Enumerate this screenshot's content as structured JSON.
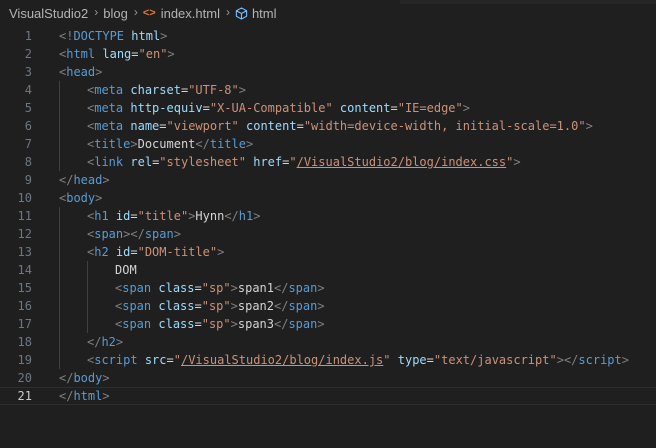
{
  "breadcrumb": {
    "items": [
      "VisualStudio2",
      "blog",
      "index.html",
      "html"
    ],
    "file_icon": "<>",
    "symbol_icon": "cube-icon"
  },
  "editor": {
    "active_line": 21,
    "lines": [
      {
        "n": "1",
        "indent": 0,
        "tokens": [
          [
            "t-punct",
            "<!"
          ],
          [
            "t-tag",
            "DOCTYPE"
          ],
          [
            "t-text",
            " "
          ],
          [
            "t-attr",
            "html"
          ],
          [
            "t-punct",
            ">"
          ]
        ]
      },
      {
        "n": "2",
        "indent": 0,
        "tokens": [
          [
            "t-punct",
            "<"
          ],
          [
            "t-tag",
            "html"
          ],
          [
            "t-text",
            " "
          ],
          [
            "t-attr",
            "lang"
          ],
          [
            "t-text",
            "="
          ],
          [
            "t-str",
            "\"en\""
          ],
          [
            "t-punct",
            ">"
          ]
        ]
      },
      {
        "n": "3",
        "indent": 0,
        "tokens": [
          [
            "t-punct",
            "<"
          ],
          [
            "t-tag",
            "head"
          ],
          [
            "t-punct",
            ">"
          ]
        ]
      },
      {
        "n": "4",
        "indent": 1,
        "tokens": [
          [
            "t-punct",
            "<"
          ],
          [
            "t-tag",
            "meta"
          ],
          [
            "t-text",
            " "
          ],
          [
            "t-attr",
            "charset"
          ],
          [
            "t-text",
            "="
          ],
          [
            "t-str",
            "\"UTF-8\""
          ],
          [
            "t-punct",
            ">"
          ]
        ]
      },
      {
        "n": "5",
        "indent": 1,
        "tokens": [
          [
            "t-punct",
            "<"
          ],
          [
            "t-tag",
            "meta"
          ],
          [
            "t-text",
            " "
          ],
          [
            "t-attr",
            "http-equiv"
          ],
          [
            "t-text",
            "="
          ],
          [
            "t-str",
            "\"X-UA-Compatible\""
          ],
          [
            "t-text",
            " "
          ],
          [
            "t-attr",
            "content"
          ],
          [
            "t-text",
            "="
          ],
          [
            "t-str",
            "\"IE=edge\""
          ],
          [
            "t-punct",
            ">"
          ]
        ]
      },
      {
        "n": "6",
        "indent": 1,
        "tokens": [
          [
            "t-punct",
            "<"
          ],
          [
            "t-tag",
            "meta"
          ],
          [
            "t-text",
            " "
          ],
          [
            "t-attr",
            "name"
          ],
          [
            "t-text",
            "="
          ],
          [
            "t-str",
            "\"viewport\""
          ],
          [
            "t-text",
            " "
          ],
          [
            "t-attr",
            "content"
          ],
          [
            "t-text",
            "="
          ],
          [
            "t-str",
            "\"width=device-width, initial-scale=1.0\""
          ],
          [
            "t-punct",
            ">"
          ]
        ]
      },
      {
        "n": "7",
        "indent": 1,
        "tokens": [
          [
            "t-punct",
            "<"
          ],
          [
            "t-tag",
            "title"
          ],
          [
            "t-punct",
            ">"
          ],
          [
            "t-text",
            "Document"
          ],
          [
            "t-punct",
            "</"
          ],
          [
            "t-tag",
            "title"
          ],
          [
            "t-punct",
            ">"
          ]
        ]
      },
      {
        "n": "8",
        "indent": 1,
        "tokens": [
          [
            "t-punct",
            "<"
          ],
          [
            "t-tag",
            "link"
          ],
          [
            "t-text",
            " "
          ],
          [
            "t-attr",
            "rel"
          ],
          [
            "t-text",
            "="
          ],
          [
            "t-str",
            "\"stylesheet\""
          ],
          [
            "t-text",
            " "
          ],
          [
            "t-attr",
            "href"
          ],
          [
            "t-text",
            "="
          ],
          [
            "t-str",
            "\""
          ],
          [
            "t-str t-link",
            "/VisualStudio2/blog/index.css"
          ],
          [
            "t-str",
            "\""
          ],
          [
            "t-punct",
            ">"
          ]
        ]
      },
      {
        "n": "9",
        "indent": 0,
        "tokens": [
          [
            "t-punct",
            "</"
          ],
          [
            "t-tag",
            "head"
          ],
          [
            "t-punct",
            ">"
          ]
        ]
      },
      {
        "n": "10",
        "indent": 0,
        "tokens": [
          [
            "t-punct",
            "<"
          ],
          [
            "t-tag",
            "body"
          ],
          [
            "t-punct",
            ">"
          ]
        ]
      },
      {
        "n": "11",
        "indent": 1,
        "tokens": [
          [
            "t-punct",
            "<"
          ],
          [
            "t-tag",
            "h1"
          ],
          [
            "t-text",
            " "
          ],
          [
            "t-attr",
            "id"
          ],
          [
            "t-text",
            "="
          ],
          [
            "t-str",
            "\"title\""
          ],
          [
            "t-punct",
            ">"
          ],
          [
            "t-text",
            "Hynn"
          ],
          [
            "t-punct",
            "</"
          ],
          [
            "t-tag",
            "h1"
          ],
          [
            "t-punct",
            ">"
          ]
        ]
      },
      {
        "n": "12",
        "indent": 1,
        "tokens": [
          [
            "t-punct",
            "<"
          ],
          [
            "t-tag",
            "span"
          ],
          [
            "t-punct",
            "></"
          ],
          [
            "t-tag",
            "span"
          ],
          [
            "t-punct",
            ">"
          ]
        ]
      },
      {
        "n": "13",
        "indent": 1,
        "tokens": [
          [
            "t-punct",
            "<"
          ],
          [
            "t-tag",
            "h2"
          ],
          [
            "t-text",
            " "
          ],
          [
            "t-attr",
            "id"
          ],
          [
            "t-text",
            "="
          ],
          [
            "t-str",
            "\"DOM-title\""
          ],
          [
            "t-punct",
            ">"
          ]
        ]
      },
      {
        "n": "14",
        "indent": 2,
        "tokens": [
          [
            "t-text",
            "DOM"
          ]
        ]
      },
      {
        "n": "15",
        "indent": 2,
        "tokens": [
          [
            "t-punct",
            "<"
          ],
          [
            "t-tag",
            "span"
          ],
          [
            "t-text",
            " "
          ],
          [
            "t-attr",
            "class"
          ],
          [
            "t-text",
            "="
          ],
          [
            "t-str",
            "\"sp\""
          ],
          [
            "t-punct",
            ">"
          ],
          [
            "t-text",
            "span1"
          ],
          [
            "t-punct",
            "</"
          ],
          [
            "t-tag",
            "span"
          ],
          [
            "t-punct",
            ">"
          ]
        ]
      },
      {
        "n": "16",
        "indent": 2,
        "tokens": [
          [
            "t-punct",
            "<"
          ],
          [
            "t-tag",
            "span"
          ],
          [
            "t-text",
            " "
          ],
          [
            "t-attr",
            "class"
          ],
          [
            "t-text",
            "="
          ],
          [
            "t-str",
            "\"sp\""
          ],
          [
            "t-punct",
            ">"
          ],
          [
            "t-text",
            "span2"
          ],
          [
            "t-punct",
            "</"
          ],
          [
            "t-tag",
            "span"
          ],
          [
            "t-punct",
            ">"
          ]
        ]
      },
      {
        "n": "17",
        "indent": 2,
        "tokens": [
          [
            "t-punct",
            "<"
          ],
          [
            "t-tag",
            "span"
          ],
          [
            "t-text",
            " "
          ],
          [
            "t-attr",
            "class"
          ],
          [
            "t-text",
            "="
          ],
          [
            "t-str",
            "\"sp\""
          ],
          [
            "t-punct",
            ">"
          ],
          [
            "t-text",
            "span3"
          ],
          [
            "t-punct",
            "</"
          ],
          [
            "t-tag",
            "span"
          ],
          [
            "t-punct",
            ">"
          ]
        ]
      },
      {
        "n": "18",
        "indent": 1,
        "tokens": [
          [
            "t-punct",
            "</"
          ],
          [
            "t-tag",
            "h2"
          ],
          [
            "t-punct",
            ">"
          ]
        ]
      },
      {
        "n": "19",
        "indent": 1,
        "tokens": [
          [
            "t-punct",
            "<"
          ],
          [
            "t-tag",
            "script"
          ],
          [
            "t-text",
            " "
          ],
          [
            "t-attr",
            "src"
          ],
          [
            "t-text",
            "="
          ],
          [
            "t-str",
            "\""
          ],
          [
            "t-str t-link",
            "/VisualStudio2/blog/index.js"
          ],
          [
            "t-str",
            "\""
          ],
          [
            "t-text",
            " "
          ],
          [
            "t-attr",
            "type"
          ],
          [
            "t-text",
            "="
          ],
          [
            "t-str",
            "\"text/javascript\""
          ],
          [
            "t-punct",
            "></"
          ],
          [
            "t-tag",
            "script"
          ],
          [
            "t-punct",
            ">"
          ]
        ]
      },
      {
        "n": "20",
        "indent": 0,
        "tokens": [
          [
            "t-punct",
            "</"
          ],
          [
            "t-tag",
            "body"
          ],
          [
            "t-punct",
            ">"
          ]
        ]
      },
      {
        "n": "21",
        "indent": 0,
        "tokens": [
          [
            "t-punct",
            "</"
          ],
          [
            "t-tag",
            "html"
          ],
          [
            "t-punct",
            ">"
          ]
        ]
      }
    ]
  }
}
